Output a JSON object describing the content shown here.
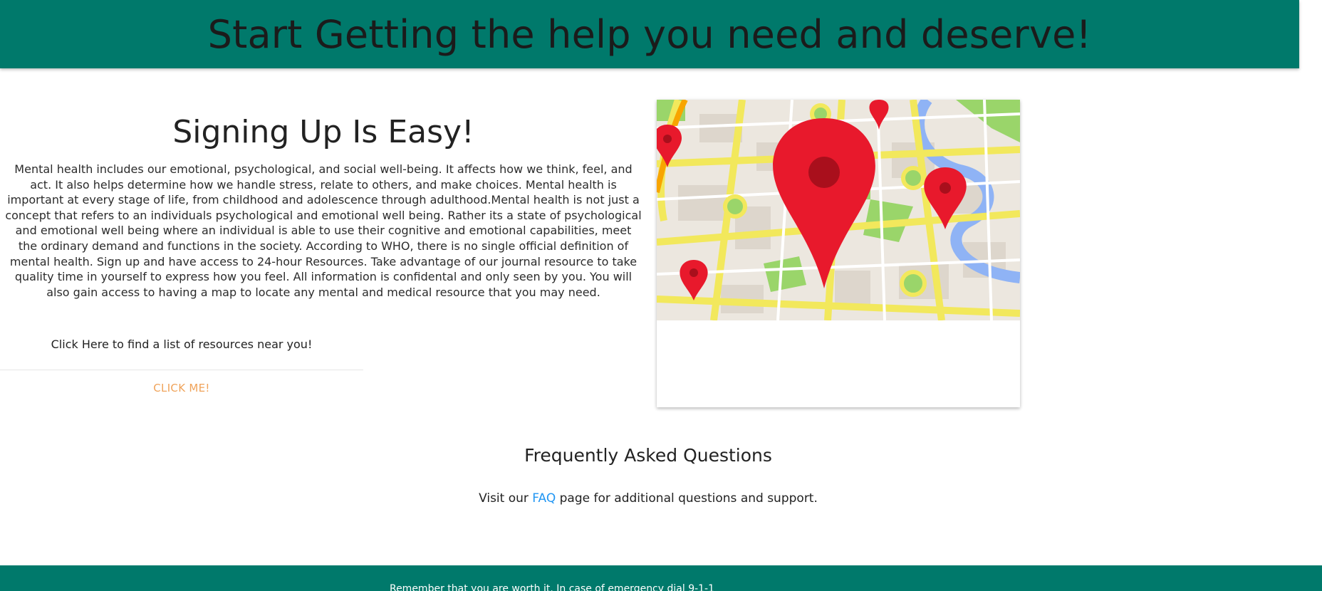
{
  "header": {
    "title": "Start Getting the help you need and deserve!"
  },
  "signup": {
    "heading": "Signing Up Is Easy!",
    "body": "Mental health includes our emotional, psychological, and social well-being. It affects how we think, feel, and act. It also helps determine how we handle stress, relate to others, and make choices. Mental health is important at every stage of life, from childhood and adolescence through adulthood.Mental health is not just a concept that refers to an individuals psychological and emotional well being. Rather its a state of psychological and emotional well being where an individual is able to use their cognitive and emotional capabilities, meet the ordinary demand and functions in the society. According to WHO, there is no single official definition of mental health. Sign up and have access to 24-hour Resources. Take advantage of our journal resource to take quality time in yourself to express how you feel. All information is confidental and only seen by you. You will also gain access to having a map to locate any mental and medical resource that you may need."
  },
  "card": {
    "image_icon": "map-with-location-pins",
    "text": "Click Here to find a list of resources near you!",
    "action_label": "CLICK ME!"
  },
  "faq": {
    "heading": "Frequently Asked Questions",
    "text_before": "Visit our ",
    "link_label": "FAQ",
    "text_after": " page for additional questions and support."
  },
  "footer": {
    "text": "Remember that you are worth it. In case of emergency dial 9-1-1"
  },
  "colors": {
    "brand_teal": "#00796b",
    "action_orange": "#f0a35a",
    "link_blue": "#2196f3",
    "pin_red": "#e8192c"
  }
}
